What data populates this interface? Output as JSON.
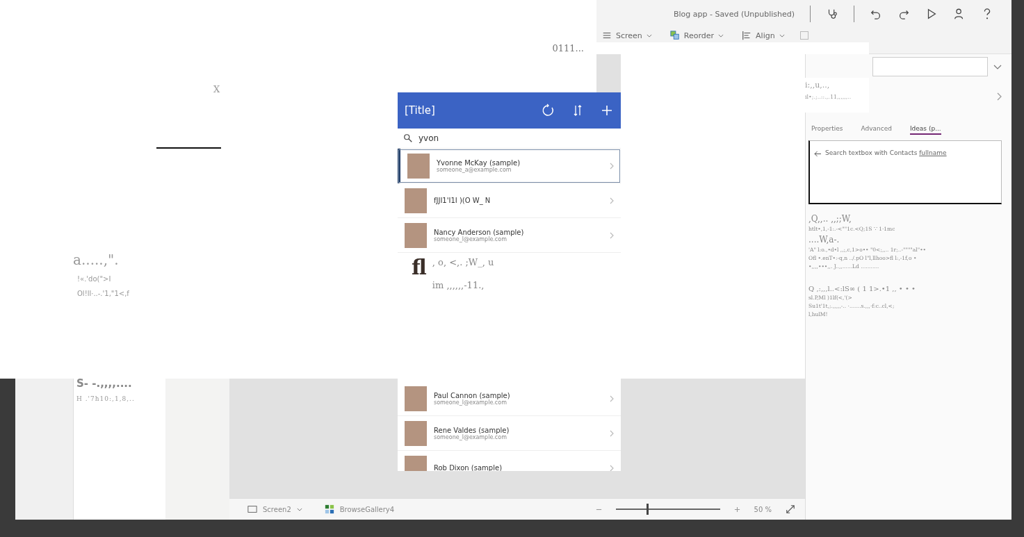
{
  "title_bar": {
    "status": "Blog app - Saved (Unpublished)"
  },
  "toolbar": {
    "items": [
      {
        "label": "Screen",
        "kind": "menu"
      },
      {
        "label": "Reorder",
        "kind": "layers"
      },
      {
        "label": "Align",
        "kind": "align"
      }
    ]
  },
  "property_panel": {
    "tabs": [
      {
        "label": "Properties",
        "selected": false
      },
      {
        "label": "Advanced",
        "selected": false
      },
      {
        "label": "Ideas (p...",
        "selected": true
      }
    ],
    "idea": {
      "text": "Search textbox with Contacts ",
      "link": "fullname"
    },
    "notes": [
      {
        "text": ",Q,,.. ,,;;W,",
        "kind": "large"
      },
      {
        "text": "htlt•,1,-1:.-<\"\"1c.<Q;1S  ∵ 1·1mc",
        "kind": "small"
      },
      {
        "text": "....W,a-.",
        "kind": "large"
      },
      {
        "text": "'A\" l:o.,•d•l ,,;,c,1>o•• \"0<;,,.. 1r;..-\"\"\"\"al\"••",
        "kind": "small"
      },
      {
        "text": "Ofl •.enT•:-q,n ../.pO l\"l,llhoo>fl l:,-1f,o •",
        "kind": "small"
      },
      {
        "text": "•,,,,•••,,. J..,,......Ld ...........",
        "kind": "small"
      },
      {
        "text": "Q ,:,,,l..<:lS∞ ( 1 1>.•1 ,, • • •",
        "kind": "gap"
      },
      {
        "text": "sl.P,Ml )1lf(<,'(>",
        "kind": "small"
      },
      {
        "text": "Su1t'1t,;.,,,,,-.. ·.......s.,,,·f:c..cl,<;",
        "kind": "small"
      },
      {
        "text": "l,hulM!",
        "kind": "small"
      }
    ]
  },
  "tree_panel": {
    "texts": [
      {
        "text": "S- -.,,,,....",
        "kind": "large"
      },
      {
        "text": "H .'7h10:,1,8,..",
        "kind": "small"
      }
    ]
  },
  "app_preview": {
    "title": "[Title]",
    "search": {
      "value": "yvon"
    },
    "rows_top": [
      {
        "name": "Yvonne McKay (sample)",
        "email": "someone_a@example.com",
        "selected": true
      },
      {
        "name": "fJJI1'I1I )(O W_ N",
        "selected": false
      },
      {
        "name": "Nancy Anderson (sample)",
        "email": "someone_l@example.com",
        "selected": false
      }
    ],
    "rows_bottom": [
      {
        "name": "Paul Cannon (sample)",
        "email": "someone_l@example.com",
        "selected": false
      },
      {
        "name": "Rene Valdes (sample)",
        "email": "someone_l@example.com",
        "selected": false
      },
      {
        "name": "Rob Dixon (sample)",
        "selected": false
      }
    ]
  },
  "status_bar": {
    "screen": "Screen2",
    "control": "BrowseGallery4",
    "zoom": {
      "level": 0.3,
      "reading": "50 %"
    }
  },
  "overlay": {
    "top": [
      {
        "text": "0111..."
      }
    ],
    "left": [
      {
        "text": "X",
        "kind": "mark"
      },
      {
        "text": "a.....,\".",
        "kind": "large"
      },
      {
        "text": "!«.'do(\">I",
        "kind": "small"
      },
      {
        "text": "Ol!ll·..-.'1,\"1<,f",
        "kind": "small"
      }
    ],
    "phone": [
      {
        "text": "fl",
        "kind": "mark"
      },
      {
        "text": ", o, <,. ;W_, u",
        "kind": "large"
      },
      {
        "text": "im ,,,,,,-11.,",
        "kind": "large"
      }
    ],
    "right": [
      {
        "text": "i:,,u,..,",
        "kind": "large"
      },
      {
        "text": "il•;.;..::.,.11,,,,,,..",
        "kind": "small"
      }
    ]
  }
}
